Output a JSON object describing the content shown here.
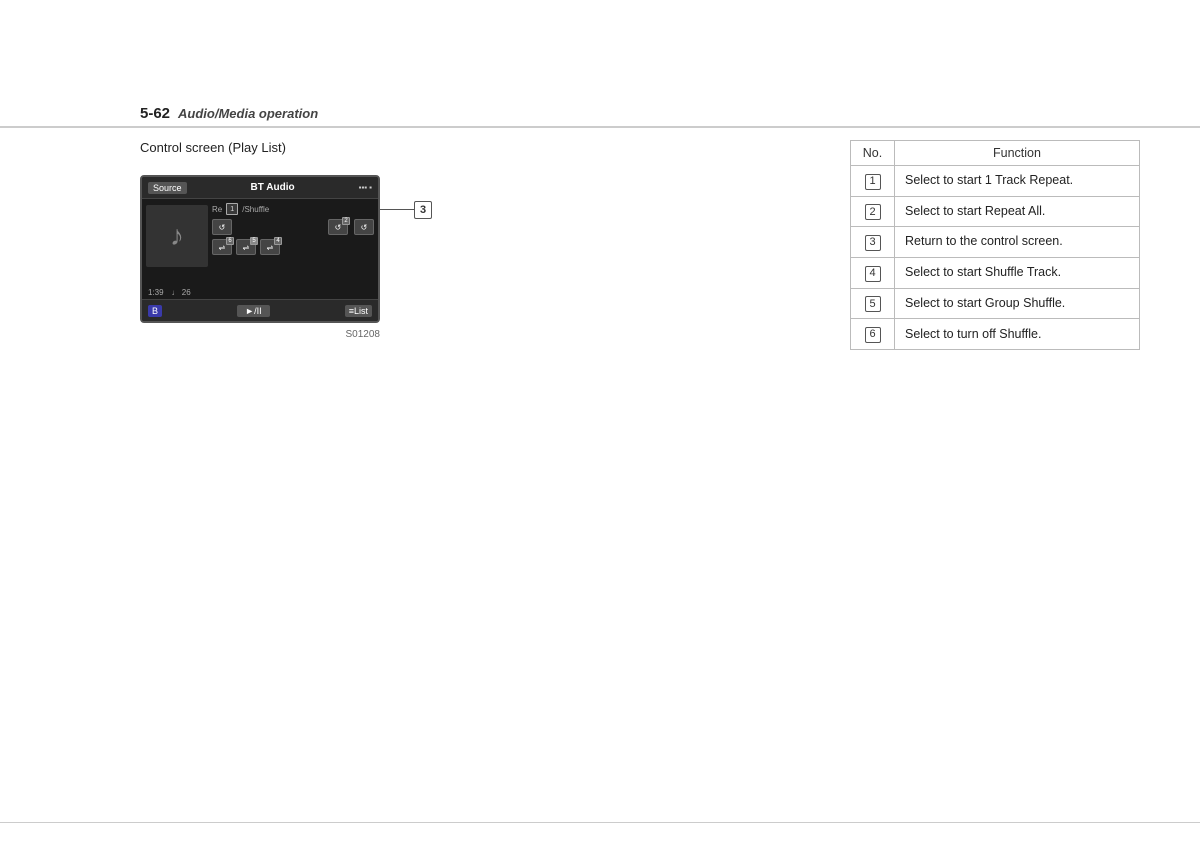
{
  "header": {
    "page_number": "5-62",
    "title": "Audio/Media operation"
  },
  "section": {
    "heading": "Control screen (Play List)"
  },
  "screen": {
    "source_btn": "Source",
    "title": "BT Audio",
    "time": "1:39",
    "track": "♩ 26",
    "play_pause": "►/II",
    "list_btn": "≡List",
    "bluetooth_icon": "B",
    "repeat_text": "Re",
    "shuffle_text": "/Shuffle",
    "image_code": "S01208",
    "callout_number": "3"
  },
  "table": {
    "col_no": "No.",
    "col_function": "Function",
    "rows": [
      {
        "no": "1",
        "text": "Select to start 1 Track Repeat."
      },
      {
        "no": "2",
        "text": "Select to start Repeat All."
      },
      {
        "no": "3",
        "text": "Return to the control screen."
      },
      {
        "no": "4",
        "text": "Select to start Shuffle Track."
      },
      {
        "no": "5",
        "text": "Select to start Group Shuffle."
      },
      {
        "no": "6",
        "text": "Select to turn off Shuffle."
      }
    ]
  }
}
